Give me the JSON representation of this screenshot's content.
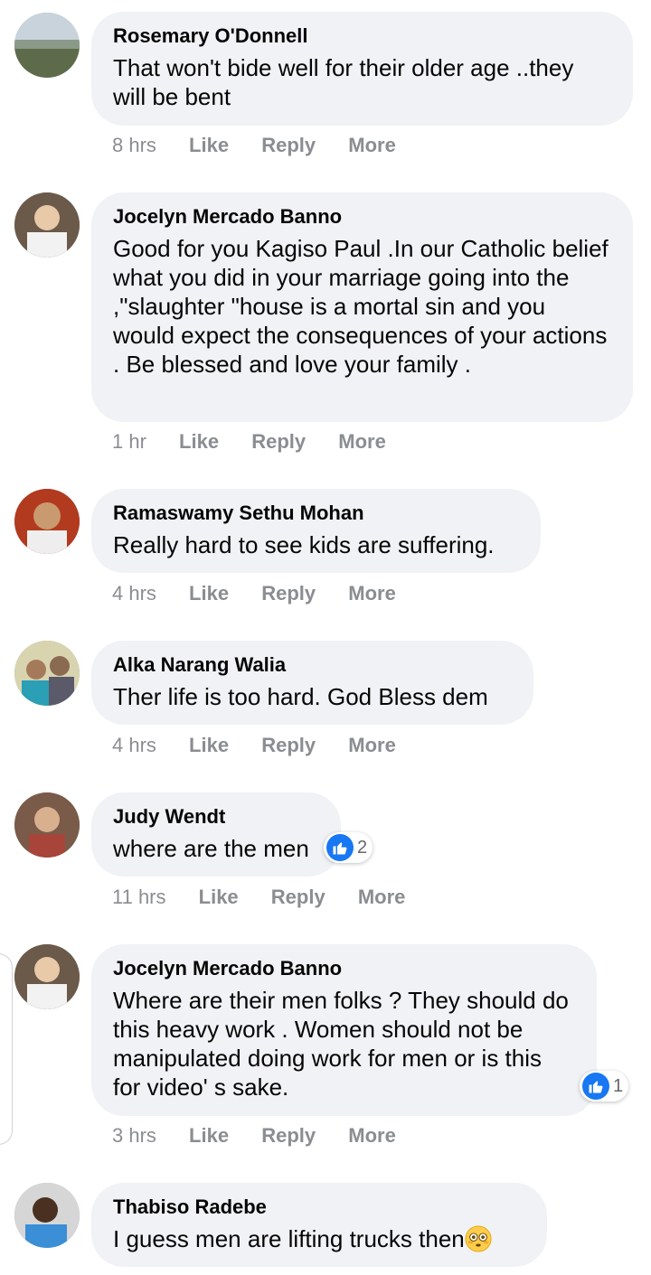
{
  "comments": [
    {
      "name": "Rosemary O'Donnell",
      "text": "That won't bide well for their older age ..they will be bent",
      "time": "8 hrs",
      "like": "Like",
      "reply": "Reply",
      "more": "More"
    },
    {
      "name": "Jocelyn Mercado Banno",
      "text": "Good for you Kagiso Paul .In our Catholic belief what you did in your marriage going into the ,\"slaughter \"house is a mortal sin and you would expect the consequences of your actions . Be blessed and love your family .",
      "time": "1 hr",
      "like": "Like",
      "reply": "Reply",
      "more": "More"
    },
    {
      "name": "Ramaswamy Sethu Mohan",
      "text": "Really hard to see kids are suffering.",
      "time": "4 hrs",
      "like": "Like",
      "reply": "Reply",
      "more": "More"
    },
    {
      "name": "Alka Narang Walia",
      "text": "Ther life is too hard. God Bless dem",
      "time": "4 hrs",
      "like": "Like",
      "reply": "Reply",
      "more": "More"
    },
    {
      "name": "Judy Wendt",
      "text": "where are the men",
      "time": "11 hrs",
      "like": "Like",
      "reply": "Reply",
      "more": "More",
      "reaction_count": "2"
    },
    {
      "name": "Jocelyn Mercado Banno",
      "text": "Where are their men folks ? They should do this heavy work . Women should not be manipulated doing work for men or is this for video' s sake.",
      "time": "3 hrs",
      "like": "Like",
      "reply": "Reply",
      "more": "More",
      "reaction_count": "1"
    },
    {
      "name": "Thabiso Radebe",
      "text": "I guess men are lifting trucks then",
      "emoji": "flushed-face-emoji"
    }
  ],
  "colors": {
    "bubble": "#f0f2f5",
    "meta": "#8a8d91",
    "like_blue": "#1877f2"
  }
}
